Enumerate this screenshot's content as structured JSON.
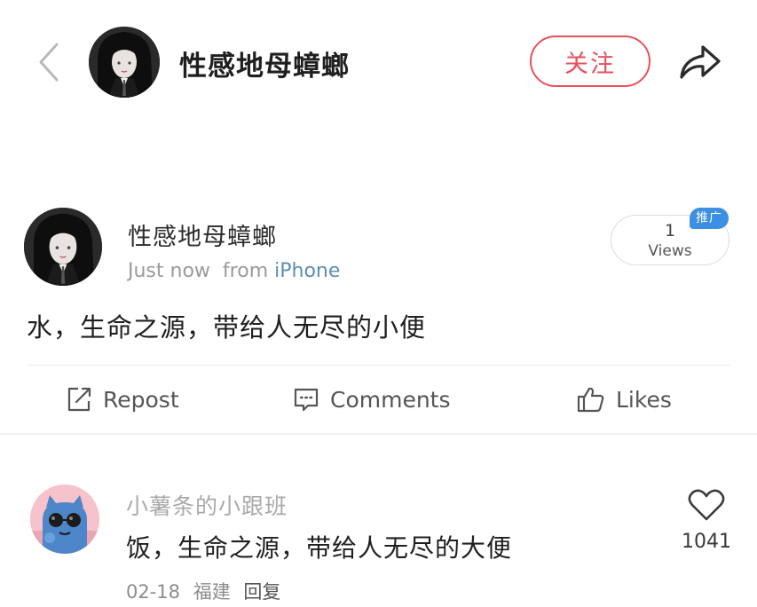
{
  "nav": {
    "username": "性感地母蟑螂",
    "follow_label": "关注"
  },
  "post": {
    "username": "性感地母蟑螂",
    "time": "Just now",
    "from_word": "from",
    "source": "iPhone",
    "views_count": "1",
    "views_label": "Views",
    "promo_badge": "推广",
    "text": "水，生命之源，带给人无尽的小便"
  },
  "actions": {
    "repost_label": "Repost",
    "comments_label": "Comments",
    "likes_label": "Likes"
  },
  "comment": {
    "username": "小薯条的小跟班",
    "text": "饭，生命之源，带给人无尽的大便",
    "date": "02-18",
    "location": "福建",
    "reply_label": "回复",
    "like_count": "1041"
  },
  "colors": {
    "accent_red": "#e8505b",
    "link_blue": "#5d8fb0",
    "badge_blue": "#3d8fe3"
  },
  "icons": {
    "back": "chevron-left-icon",
    "share": "share-arrow-icon",
    "repost": "repost-icon",
    "comments": "comment-bubble-icon",
    "likes": "thumbs-up-icon",
    "comment_like": "heart-icon"
  }
}
